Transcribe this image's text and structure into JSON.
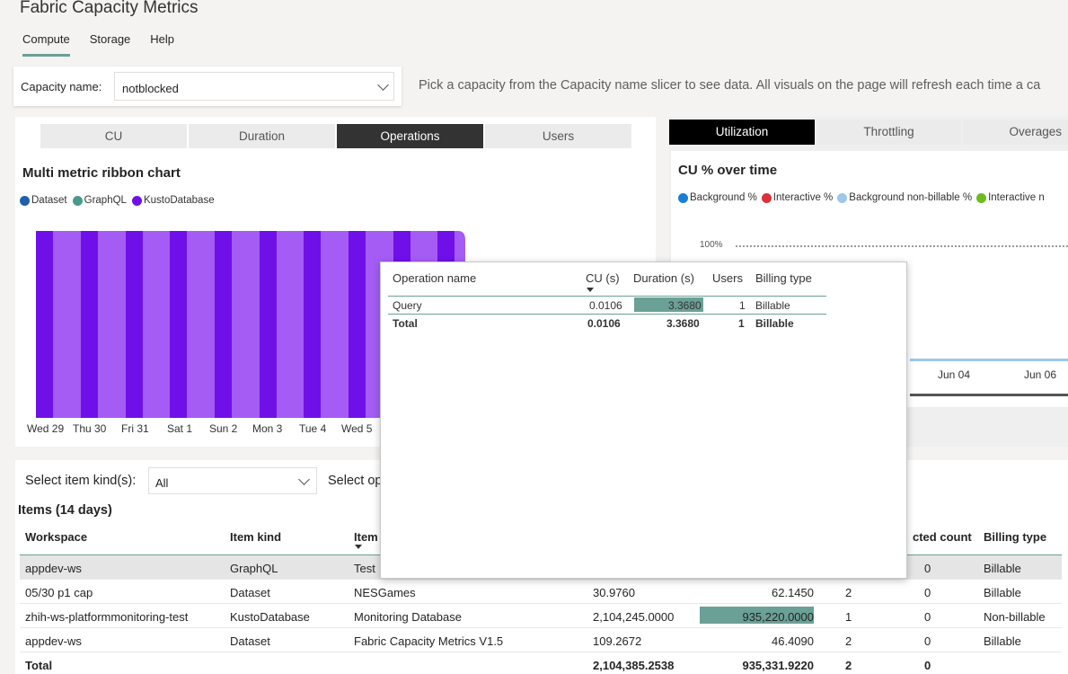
{
  "app": {
    "title": "Fabric Capacity Metrics"
  },
  "nav": {
    "tabs": [
      "Compute",
      "Storage",
      "Help"
    ],
    "active": "Compute"
  },
  "capacity_slicer": {
    "label": "Capacity name:",
    "value": "notblocked"
  },
  "instruction": "Pick a capacity from the Capacity name slicer to see data. All visuals on the page will refresh each time a ca",
  "left_card": {
    "tabs": [
      "CU",
      "Duration",
      "Operations",
      "Users"
    ],
    "active_tab": "Operations",
    "title": "Multi metric ribbon chart",
    "legend": [
      {
        "label": "Dataset",
        "color": "#1f5fad"
      },
      {
        "label": "GraphQL",
        "color": "#4a9a8c"
      },
      {
        "label": "KustoDatabase",
        "color": "#7010e8"
      }
    ],
    "x_labels": [
      "Wed 29",
      "Thu 30",
      "Fri 31",
      "Sat 1",
      "Sun 2",
      "Mon 3",
      "Tue 4",
      "Wed 5"
    ]
  },
  "right_card": {
    "tabs": [
      "Utilization",
      "Throttling",
      "Overages"
    ],
    "active_tab": "Utilization",
    "title": "CU % over time",
    "legend": [
      {
        "label": "Background %",
        "color": "#1a7fd4"
      },
      {
        "label": "Interactive %",
        "color": "#d9323a"
      },
      {
        "label": "Background non-billable %",
        "color": "#9dc8ec"
      },
      {
        "label": "Interactive n",
        "color": "#6dbb1e"
      }
    ],
    "y_tick": "100%",
    "x_labels": [
      "Jun 04",
      "Jun 06"
    ]
  },
  "bottom_card": {
    "item_kind_label": "Select item kind(s):",
    "item_kind_value": "All",
    "select_op_label": "Select op",
    "items_title": "Items (14 days)",
    "columns": [
      "Workspace",
      "Item kind",
      "Item",
      "cted count",
      "Billing type"
    ],
    "rows": [
      {
        "workspace": "appdev-ws",
        "kind": "GraphQL",
        "item": "Test",
        "cu": "",
        "duration": "",
        "users": "",
        "count": "0",
        "billing": "Billable",
        "selected": true
      },
      {
        "workspace": "05/30 p1 cap",
        "kind": "Dataset",
        "item": "NESGames",
        "cu": "30.9760",
        "duration": "62.1450",
        "users": "2",
        "count": "0",
        "billing": "Billable"
      },
      {
        "workspace": "zhih-ws-platformmonitoring-test",
        "kind": "KustoDatabase",
        "item": "Monitoring Database",
        "cu": "2,104,245.0000",
        "duration": "935,220.0000",
        "users": "1",
        "count": "0",
        "billing": "Non-billable",
        "bar": true
      },
      {
        "workspace": "appdev-ws",
        "kind": "Dataset",
        "item": "Fabric Capacity Metrics V1.5",
        "cu": "109.2672",
        "duration": "46.4090",
        "users": "2",
        "count": "0",
        "billing": "Billable"
      }
    ],
    "total": {
      "label": "Total",
      "cu": "2,104,385.2538",
      "duration": "935,331.9220",
      "users": "2",
      "count": "0"
    }
  },
  "tooltip": {
    "columns": [
      "Operation name",
      "CU (s)",
      "Duration (s)",
      "Users",
      "Billing type"
    ],
    "row": {
      "name": "Query",
      "cu": "0.0106",
      "duration": "3.3680",
      "users": "1",
      "billing": "Billable"
    },
    "total": {
      "name": "Total",
      "cu": "0.0106",
      "duration": "3.3680",
      "users": "1",
      "billing": "Billable"
    }
  }
}
